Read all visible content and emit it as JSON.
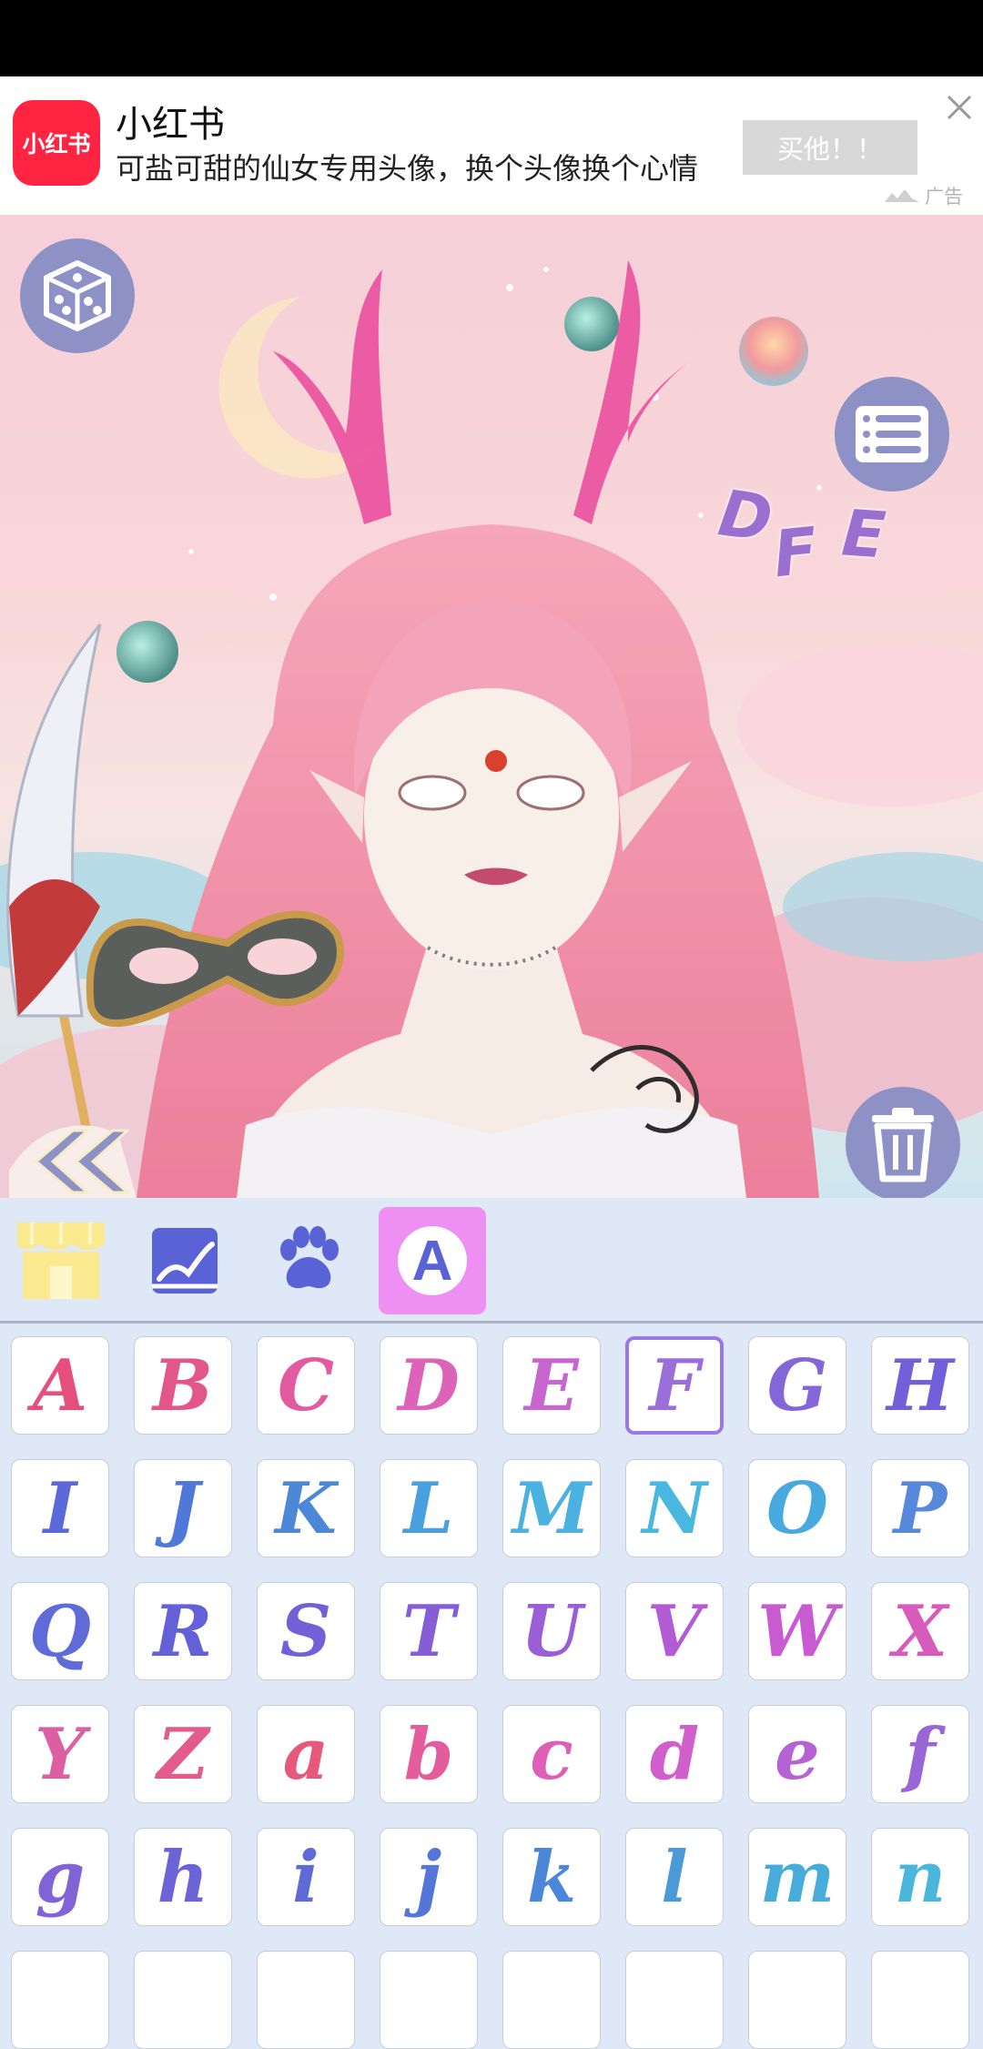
{
  "ad": {
    "app_name": "小红书",
    "logo_text": "小红书",
    "description": "可盐可甜的仙女专用头像，换个头像换个心情",
    "cta_label": "买他！！",
    "tag": "广告"
  },
  "canvas": {
    "deco_letters": [
      "D",
      "F",
      "E"
    ]
  },
  "categories": [
    {
      "name": "shop",
      "icon": "shop-icon"
    },
    {
      "name": "background",
      "icon": "landscape-icon"
    },
    {
      "name": "pets",
      "icon": "paw-icon"
    },
    {
      "name": "letters",
      "icon": "letter-a-icon",
      "label": "A",
      "active": true
    }
  ],
  "letters": {
    "selected": "F",
    "rows": [
      [
        "A",
        "B",
        "C",
        "D",
        "E",
        "F",
        "G",
        "H"
      ],
      [
        "I",
        "J",
        "K",
        "L",
        "M",
        "N",
        "O",
        "P"
      ],
      [
        "Q",
        "R",
        "S",
        "T",
        "U",
        "V",
        "W",
        "X"
      ],
      [
        "Y",
        "Z",
        "a",
        "b",
        "c",
        "d",
        "e",
        "f"
      ],
      [
        "g",
        "h",
        "i",
        "j",
        "k",
        "l",
        "m",
        "n"
      ]
    ],
    "colors": [
      [
        "#e64f7d",
        "#e2568a",
        "#e45aa0",
        "#dd63b9",
        "#c866cf",
        "#9a6fd8",
        "#8566d9",
        "#7260d8"
      ],
      [
        "#5b6ad8",
        "#4f78d8",
        "#4c87d8",
        "#4aa0de",
        "#4bb1e0",
        "#48b8e0",
        "#47a9de",
        "#5688dc"
      ],
      [
        "#5f6bd9",
        "#6460d8",
        "#7360d7",
        "#855dd7",
        "#9a5fd7",
        "#b25bd5",
        "#c85bd2",
        "#d75bba"
      ],
      [
        "#dc5fa3",
        "#e25b8b",
        "#e6597c",
        "#e35c9c",
        "#dd5fb7",
        "#d05fcb",
        "#b562d3",
        "#9966d6"
      ],
      [
        "#8263d6",
        "#6c64d6",
        "#5f6ad6",
        "#5476d8",
        "#4b86d8",
        "#4a9ad8",
        "#48acdb",
        "#4ab6db"
      ]
    ]
  }
}
